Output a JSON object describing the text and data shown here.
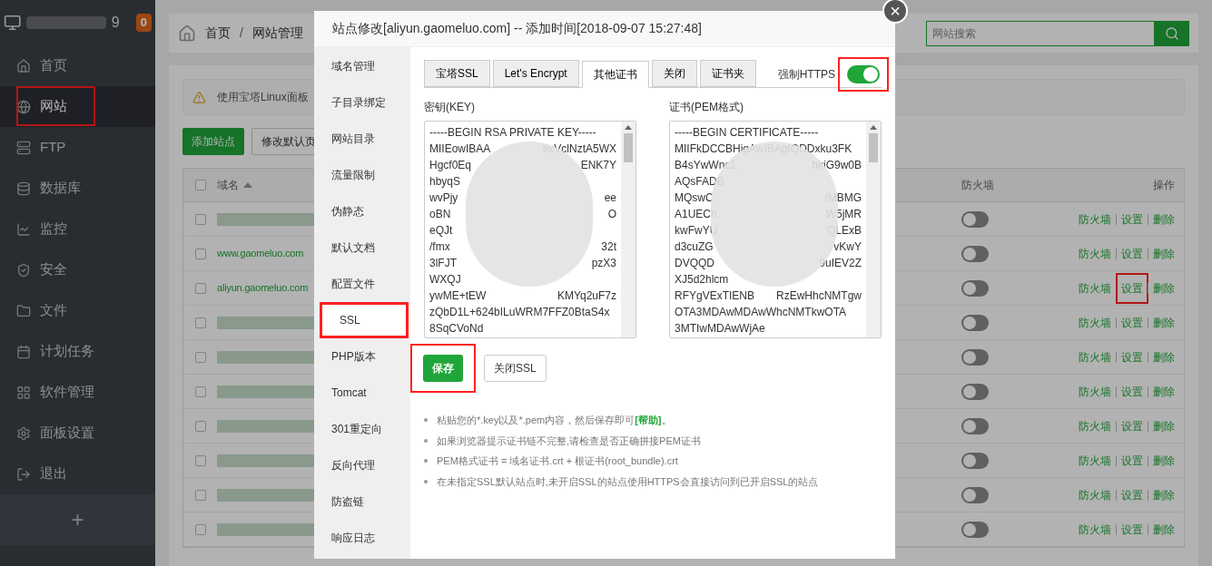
{
  "sidebar": {
    "user_suffix": "9",
    "badge": "0",
    "items": [
      {
        "label": "首页",
        "selected": false,
        "highlighted": false
      },
      {
        "label": "网站",
        "selected": true,
        "highlighted": true
      },
      {
        "label": "FTP",
        "selected": false,
        "highlighted": false
      },
      {
        "label": "数据库",
        "selected": false,
        "highlighted": false
      },
      {
        "label": "监控",
        "selected": false,
        "highlighted": false
      },
      {
        "label": "安全",
        "selected": false,
        "highlighted": false
      },
      {
        "label": "文件",
        "selected": false,
        "highlighted": false
      },
      {
        "label": "计划任务",
        "selected": false,
        "highlighted": false
      },
      {
        "label": "软件管理",
        "selected": false,
        "highlighted": false
      },
      {
        "label": "面板设置",
        "selected": false,
        "highlighted": false
      },
      {
        "label": "退出",
        "selected": false,
        "highlighted": false
      }
    ],
    "add": "+"
  },
  "breadcrumb": [
    "首页",
    "网站管理"
  ],
  "breadcrumb_separator": "/",
  "search": {
    "placeholder": "网站搜索"
  },
  "alert": "使用宝塔Linux面板",
  "buttons": [
    "添加站点",
    "修改默认页"
  ],
  "table": {
    "columns": [
      "域名",
      "防火墙",
      "操作"
    ],
    "select_all_checked": false,
    "rows": [
      {
        "checked": false,
        "domain": "",
        "firewall": false,
        "actions": [
          "防火墙",
          "设置",
          "删除"
        ],
        "highlight_action": false
      },
      {
        "checked": false,
        "domain": "www.gaomeluo.com",
        "firewall": false,
        "actions": [
          "防火墙",
          "设置",
          "删除"
        ],
        "highlight_action": false
      },
      {
        "checked": false,
        "domain": "aliyun.gaomeluo.com",
        "firewall": false,
        "actions": [
          "防火墙",
          "设置",
          "删除"
        ],
        "highlight_action": true
      },
      {
        "checked": false,
        "domain": "",
        "firewall": false,
        "actions": [
          "防火墙",
          "设置",
          "删除"
        ],
        "highlight_action": false
      },
      {
        "checked": false,
        "domain": "",
        "firewall": false,
        "actions": [
          "防火墙",
          "设置",
          "删除"
        ],
        "highlight_action": false
      },
      {
        "checked": false,
        "domain": "",
        "firewall": false,
        "actions": [
          "防火墙",
          "设置",
          "删除"
        ],
        "highlight_action": false
      },
      {
        "checked": false,
        "domain": "",
        "firewall": false,
        "actions": [
          "防火墙",
          "设置",
          "删除"
        ],
        "highlight_action": false
      },
      {
        "checked": false,
        "domain": "",
        "firewall": false,
        "actions": [
          "防火墙",
          "设置",
          "删除"
        ],
        "highlight_action": false
      },
      {
        "checked": false,
        "domain": "",
        "firewall": false,
        "actions": [
          "防火墙",
          "设置",
          "删除"
        ],
        "highlight_action": false
      },
      {
        "checked": false,
        "domain": "",
        "firewall": false,
        "actions": [
          "防火墙",
          "设置",
          "删除"
        ],
        "highlight_action": false
      }
    ]
  },
  "modal": {
    "title": "站点修改[aliyun.gaomeluo.com] -- 添加时间[2018-09-07 15:27:48]",
    "close": "×",
    "nav": [
      {
        "label": "域名管理",
        "selected": false
      },
      {
        "label": "子目录绑定",
        "selected": false
      },
      {
        "label": "网站目录",
        "selected": false
      },
      {
        "label": "流量限制",
        "selected": false
      },
      {
        "label": "伪静态",
        "selected": false
      },
      {
        "label": "默认文档",
        "selected": false
      },
      {
        "label": "配置文件",
        "selected": false
      },
      {
        "label": "SSL",
        "selected": true
      },
      {
        "label": "PHP版本",
        "selected": false
      },
      {
        "label": "Tomcat",
        "selected": false
      },
      {
        "label": "301重定向",
        "selected": false
      },
      {
        "label": "反向代理",
        "selected": false
      },
      {
        "label": "防盗链",
        "selected": false
      },
      {
        "label": "响应日志",
        "selected": false
      }
    ],
    "tabs": [
      {
        "label": "宝塔SSL",
        "selected": false
      },
      {
        "label": "Let's Encrypt",
        "selected": false
      },
      {
        "label": "其他证书",
        "selected": true
      },
      {
        "label": "关闭",
        "selected": false
      },
      {
        "label": "证书夹",
        "selected": false
      }
    ],
    "force_https": {
      "label": "强制HTTPS",
      "on": true
    },
    "key": {
      "label": "密钥(KEY)",
      "lines": [
        [
          "-----BEGIN RSA PRIVATE KEY-----"
        ],
        [
          "MIIEowIBAA",
          "exVclNztA5WX"
        ],
        [
          "Hgcf0Eq",
          "ENK7Y"
        ],
        [
          "hbyqS"
        ],
        [
          "wvPjy",
          "ee"
        ],
        [
          "oBN",
          "O"
        ],
        [
          "eQJt"
        ],
        [
          "/fmx",
          "32t"
        ],
        [
          "3lFJT",
          "pzX3"
        ],
        [
          "WXQJ"
        ],
        [
          "ywME+tEW",
          "KMYq2uF7z"
        ],
        [
          "zQbD1L+624bILuWRM7FFZ0BtaS4x"
        ],
        [
          "8SqCVoNd"
        ]
      ]
    },
    "cert": {
      "label": "证书(PEM格式)",
      "lines": [
        [
          "-----BEGIN CERTIFICATE-----"
        ],
        [
          "MIIFkDCCBHigAwIBAgIQDDxku3FK"
        ],
        [
          "B4sYwWnc1",
          "hkiG9w0B"
        ],
        [
          "AQsFADB"
        ],
        [
          "MQswC",
          "/MBMG"
        ],
        [
          "A1UECh",
          "W5jMR"
        ],
        [
          "kwFwYU",
          "QLExB"
        ],
        [
          "d3cuZG",
          "vKwY"
        ],
        [
          "DVQQD",
          "9uIEV2Z"
        ],
        [
          "XJ5d2hlcm"
        ],
        [
          "RFYgVExTIENB",
          "RzEwHhcNMTgw"
        ],
        [
          "OTA3MDAwMDAwWhcNMTkwOTA"
        ],
        [
          "3MTIwMDAwWjAe"
        ]
      ]
    },
    "save": "保存",
    "close_ssl": "关闭SSL",
    "notes": [
      "粘贴您的*.key以及*.pem内容，然后保存即可**[帮助]**。",
      "如果浏览器提示证书链不完整,请检查是否正确拼接PEM证书",
      "PEM格式证书 = 域名证书.crt + 根证书(root_bundle).crt",
      "在未指定SSL默认站点时,未开启SSL的站点使用HTTPS会直接访问到已开启SSL的站点"
    ]
  }
}
